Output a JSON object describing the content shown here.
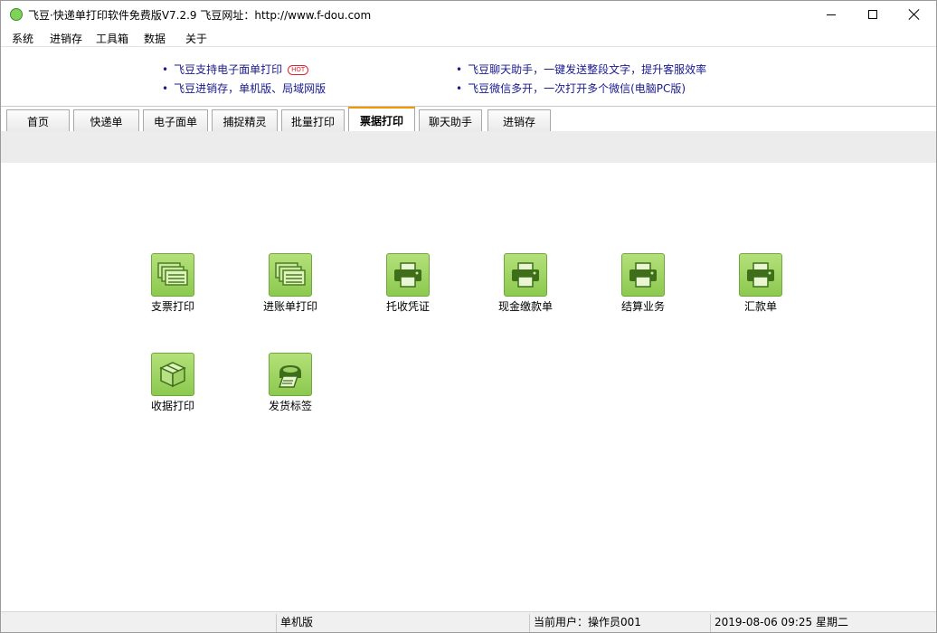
{
  "window": {
    "title": "飞豆·快递单打印软件免费版V7.2.9  飞豆网址：http://www.f-dou.com"
  },
  "menu": [
    "系统",
    "进销存",
    "工具箱",
    "数据",
    "关于"
  ],
  "ads": {
    "left": [
      {
        "text": "飞豆支持电子面单打印",
        "badge": "HOT"
      },
      {
        "text": "飞豆进销存，单机版、局域网版",
        "badge": ""
      }
    ],
    "right": [
      {
        "text": "飞豆聊天助手，一键发送整段文字，提升客服效率"
      },
      {
        "text": "飞豆微信多开，一次打开多个微信(电脑PC版)"
      }
    ],
    "bullet": "•"
  },
  "tabs": [
    {
      "label": "首页",
      "active": false
    },
    {
      "label": "快递单",
      "active": false
    },
    {
      "label": "电子面单",
      "active": false
    },
    {
      "label": "捕捉精灵",
      "active": false
    },
    {
      "label": "批量打印",
      "active": false
    },
    {
      "label": "票据打印",
      "active": true
    },
    {
      "label": "聊天助手",
      "active": false
    },
    {
      "label": "进销存",
      "active": false
    }
  ],
  "tiles": [
    {
      "label": "支票打印",
      "icon": "stacked-forms-icon"
    },
    {
      "label": "进账单打印",
      "icon": "stacked-forms-icon"
    },
    {
      "label": "托收凭证",
      "icon": "printer-icon"
    },
    {
      "label": "现金缴款单",
      "icon": "printer-icon"
    },
    {
      "label": "结算业务",
      "icon": "printer-icon"
    },
    {
      "label": "汇款单",
      "icon": "printer-icon"
    },
    {
      "label": "收据打印",
      "icon": "box-icon"
    },
    {
      "label": "发货标签",
      "icon": "label-printer-icon"
    }
  ],
  "status": {
    "mode": "单机版",
    "user": "当前用户：操作员001",
    "datetime": "2019-08-06 09:25 星期二"
  },
  "colors": {
    "tile_green": "#8cc94f",
    "active_tab_accent": "#f39800",
    "ad_link": "#1a1a8c"
  }
}
